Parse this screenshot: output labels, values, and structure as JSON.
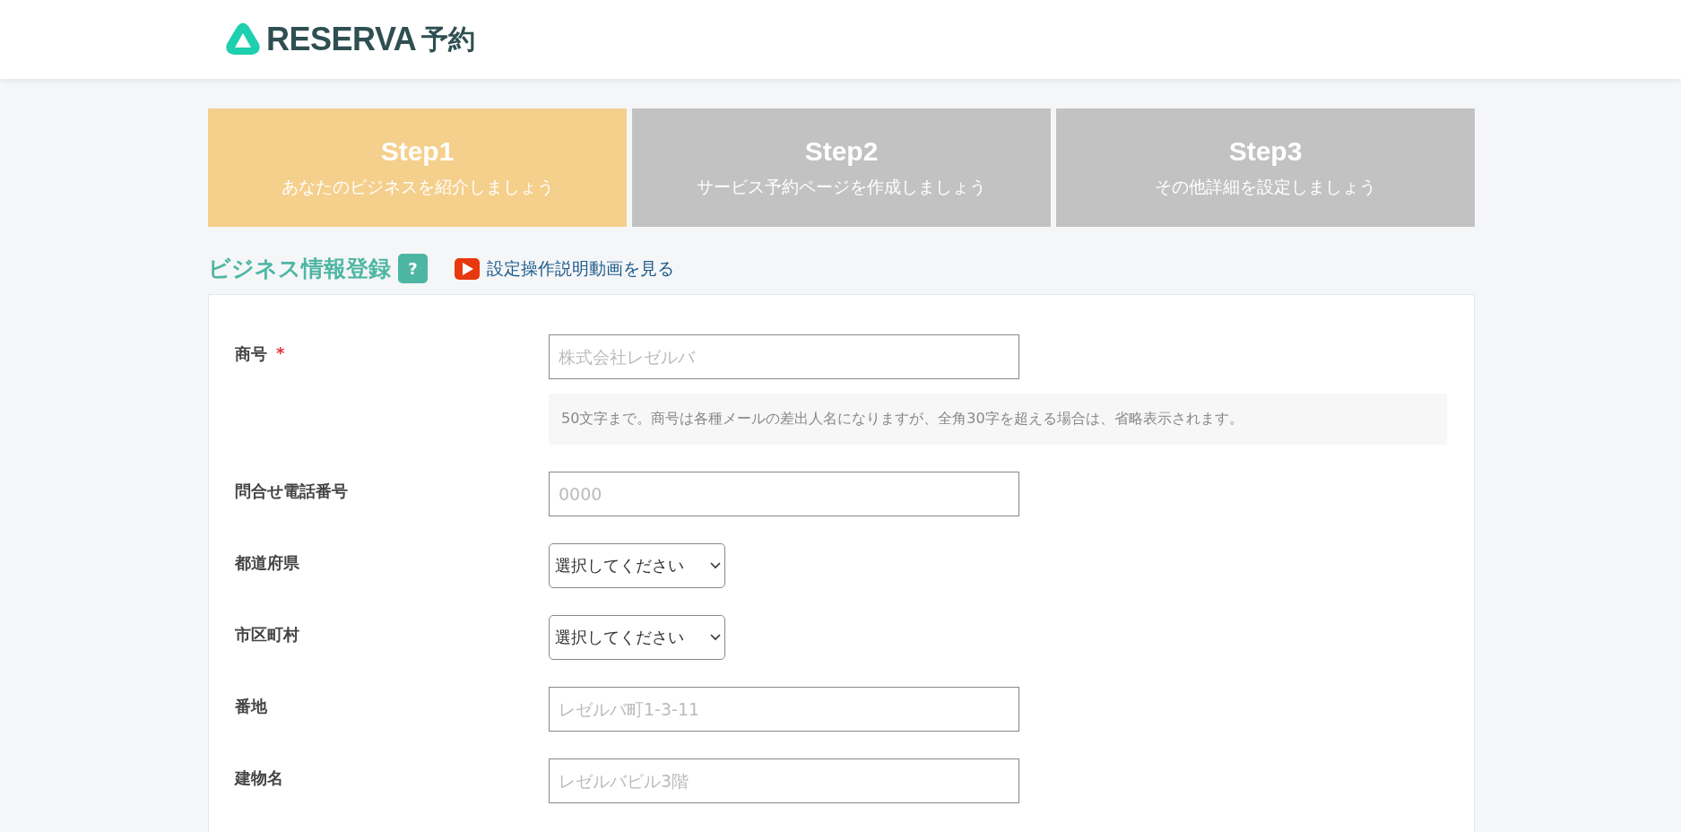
{
  "header": {
    "logo_text": "RESERVA",
    "logo_suffix": "予約"
  },
  "steps": [
    {
      "title": "Step1",
      "subtitle": "あなたのビジネスを紹介しましょう",
      "selected": true
    },
    {
      "title": "Step2",
      "subtitle": "サービス予約ページを作成しましょう",
      "selected": false
    },
    {
      "title": "Step3",
      "subtitle": "その他詳細を設定しましょう",
      "selected": false
    }
  ],
  "section": {
    "title": "ビジネス情報登録",
    "help": "?",
    "video_link": "設定操作説明動画を見る"
  },
  "fields": [
    {
      "kind": "text",
      "label": "商号",
      "required": true,
      "required_mark": "*",
      "placeholder": "株式会社レゼルバ",
      "hint": "50文字まで。商号は各種メールの差出人名になりますが、全角30字を超える場合は、省略表示されます。"
    },
    {
      "kind": "text",
      "label": "問合せ電話番号",
      "required": false,
      "placeholder": "0000"
    },
    {
      "kind": "select",
      "label": "都道府県",
      "required": false,
      "value": "選択してください"
    },
    {
      "kind": "select",
      "label": "市区町村",
      "required": false,
      "value": "選択してください"
    },
    {
      "kind": "text",
      "label": "番地",
      "required": false,
      "placeholder": "レゼルバ町1-3-11"
    },
    {
      "kind": "text",
      "label": "建物名",
      "required": false,
      "placeholder": "レゼルバビル3階"
    }
  ]
}
